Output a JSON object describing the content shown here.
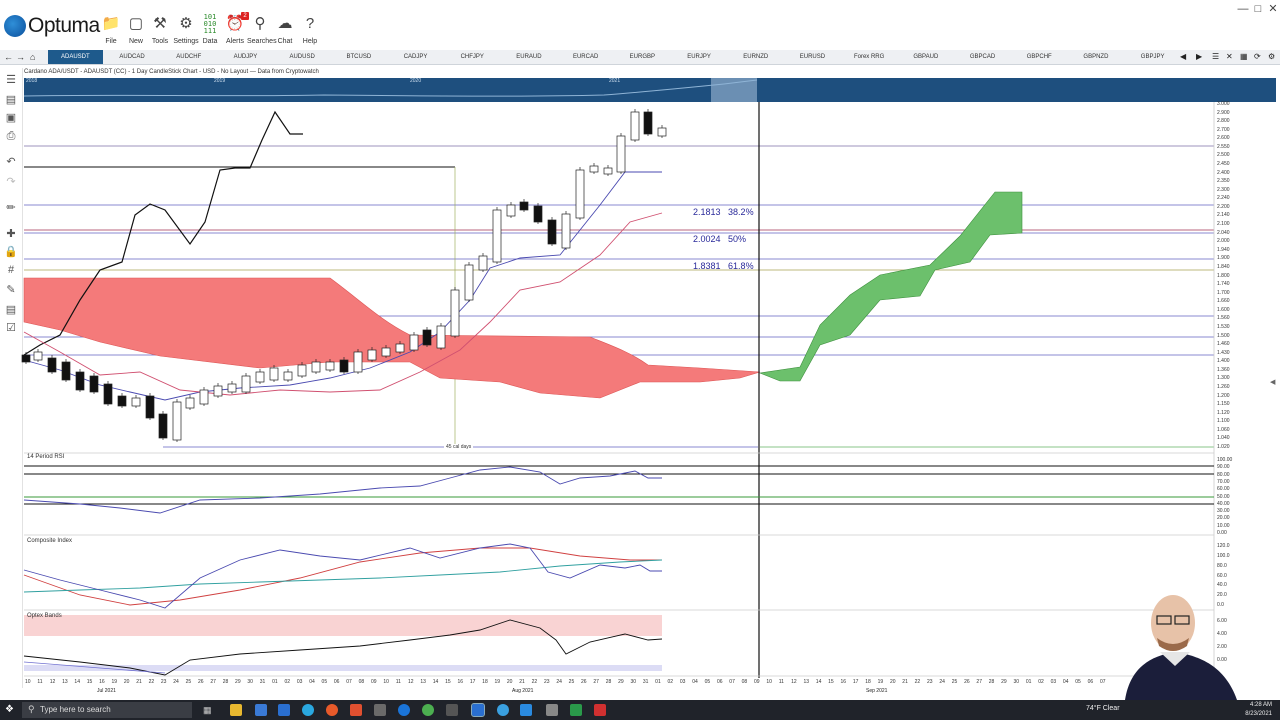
{
  "app": {
    "name": "Optuma",
    "toolbar": [
      {
        "label": "File",
        "icon": "folder-icon"
      },
      {
        "label": "New",
        "icon": "new-window-icon"
      },
      {
        "label": "Tools",
        "icon": "tools-icon"
      },
      {
        "label": "Settings",
        "icon": "gear-icon"
      },
      {
        "label": "Data",
        "icon": "data-icon"
      },
      {
        "label": "Alerts",
        "icon": "alarm-icon"
      },
      {
        "label": "Searches",
        "icon": "search-icon"
      },
      {
        "label": "Chat",
        "icon": "chat-icon"
      },
      {
        "label": "Help",
        "icon": "help-icon"
      }
    ],
    "alerts_badge": "2"
  },
  "tabs": [
    "ADAUSDT",
    "AUDCAD",
    "AUDCHF",
    "AUDJPY",
    "AUDUSD",
    "BTCUSD",
    "CADJPY",
    "CHFJPY",
    "EURAUD",
    "EURCAD",
    "EURGBP",
    "EURJPY",
    "EURNZD",
    "EURUSD",
    "Forex RRG",
    "GBPAUD",
    "GBPCAD",
    "GBPCHF",
    "GBPNZD",
    "GBPJPY"
  ],
  "active_tab": "ADAUSDT",
  "chart": {
    "header": "Cardano ADA/USDT - ADAUSDT (CC) - 1 Day CandleStick Chart - USD - No Layout — Data from Cryptowatch",
    "overview_years": [
      "2018",
      "2019",
      "2020",
      "2021"
    ],
    "fib_levels": [
      {
        "value": "2.1813",
        "pct": "38.2%"
      },
      {
        "value": "2.0024",
        "pct": "50%"
      },
      {
        "value": "1.8381",
        "pct": "61.8%"
      }
    ],
    "cal_days_label": "45 cal days",
    "price_axis": [
      "3.000",
      "2.900",
      "2.800",
      "2.700",
      "2.600",
      "2.550",
      "2.500",
      "2.450",
      "2.400",
      "2.350",
      "2.300",
      "2.240",
      "2.200",
      "2.140",
      "2.100",
      "2.040",
      "2.000",
      "1.940",
      "1.900",
      "1.840",
      "1.800",
      "1.740",
      "1.700",
      "1.660",
      "1.600",
      "1.560",
      "1.530",
      "1.500",
      "1.460",
      "1.430",
      "1.400",
      "1.360",
      "1.300",
      "1.260",
      "1.200",
      "1.150",
      "1.120",
      "1.100",
      "1.060",
      "1.040",
      "1.020"
    ],
    "rsi": {
      "title": "14 Period RSI",
      "axis": [
        "100.00",
        "90.00",
        "80.00",
        "70.00",
        "60.00",
        "50.00",
        "40.00",
        "30.00",
        "20.00",
        "10.00",
        "0.00"
      ]
    },
    "composite": {
      "title": "Composite Index",
      "axis": [
        "120.0",
        "100.0",
        "80.0",
        "60.0",
        "40.0",
        "20.0",
        "0.0"
      ]
    },
    "optex": {
      "title": "Optex Bands",
      "axis": [
        "6.00",
        "4.00",
        "2.00",
        "0.00"
      ]
    },
    "date_axis": [
      "10",
      "11",
      "12",
      "13",
      "14",
      "15",
      "16",
      "19",
      "20",
      "21",
      "22",
      "23",
      "24",
      "25",
      "26",
      "27",
      "28",
      "29",
      "30",
      "31",
      "01",
      "02",
      "03",
      "04",
      "05",
      "06",
      "07",
      "08",
      "09",
      "10",
      "11",
      "12",
      "13",
      "14",
      "15",
      "16",
      "17",
      "18",
      "19",
      "20",
      "21",
      "22",
      "23",
      "24",
      "25",
      "26",
      "27",
      "28",
      "29",
      "30",
      "31",
      "01",
      "02",
      "03",
      "04",
      "05",
      "06",
      "07",
      "08",
      "09",
      "10",
      "11",
      "12",
      "13",
      "14",
      "15",
      "16",
      "17",
      "18",
      "19",
      "20",
      "21",
      "22",
      "23",
      "24",
      "25",
      "26",
      "27",
      "28",
      "29",
      "30",
      "01",
      "02",
      "03",
      "04",
      "05",
      "06",
      "07"
    ],
    "months": [
      "Jul 2021",
      "Aug 2021",
      "Sep 2021"
    ]
  },
  "taskbar": {
    "search_placeholder": "Type here to search",
    "weather": "74°F  Clear",
    "time": "4:28 AM",
    "date": "8/23/2021"
  },
  "colors": {
    "accent": "#1e5a8c",
    "cloud_bear": "#f26b6b",
    "cloud_bull": "#6fc06f"
  }
}
